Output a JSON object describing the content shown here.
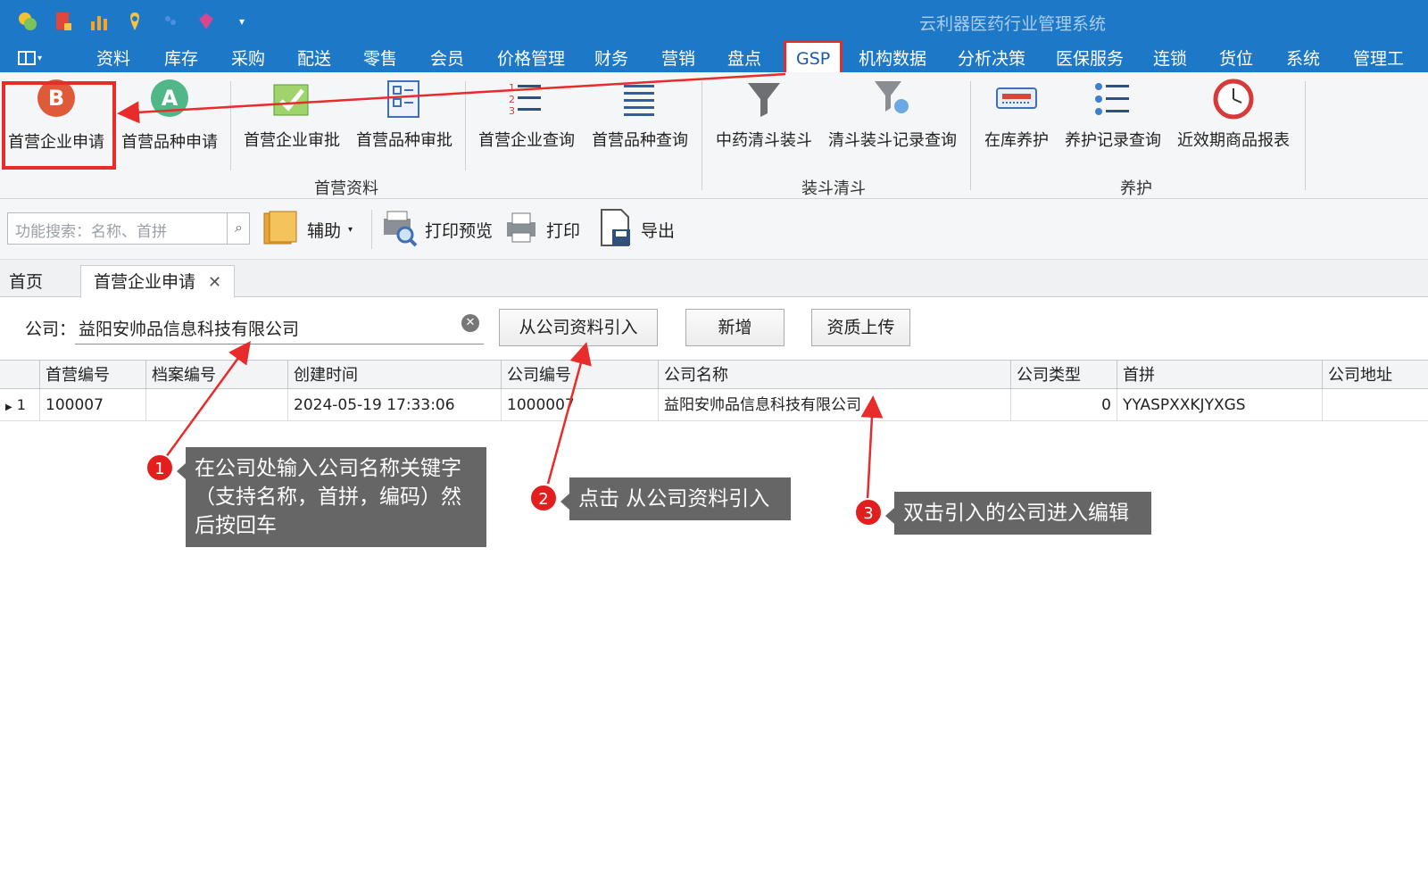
{
  "app": {
    "title": "云利器医药行业管理系统"
  },
  "menu": {
    "items": [
      "资料",
      "库存",
      "采购",
      "配送",
      "零售",
      "会员",
      "价格管理",
      "财务",
      "营销",
      "盘点",
      "GSP",
      "机构数据",
      "分析决策",
      "医保服务",
      "连锁",
      "货位",
      "系统",
      "管理工"
    ],
    "active": "GSP"
  },
  "ribbon": {
    "groups": {
      "g1": "首营资料",
      "g2": "装斗清斗",
      "g3": "养护"
    },
    "buttons": {
      "b1": "首营企业申请",
      "b2": "首营品种申请",
      "b3": "首营企业审批",
      "b4": "首营品种审批",
      "b5": "首营企业查询",
      "b6": "首营品种查询",
      "b7": "中药清斗装斗",
      "b8": "清斗装斗记录查询",
      "b9": "在库养护",
      "b10": "养护记录查询",
      "b11": "近效期商品报表"
    }
  },
  "toolbar": {
    "search_placeholder": "功能搜索：名称、首拼",
    "assist": "辅助",
    "print_preview": "打印预览",
    "print": "打印",
    "export": "导出"
  },
  "tabs": {
    "home": "首页",
    "current": "首营企业申请"
  },
  "filter": {
    "label": "公司：",
    "value": "益阳安帅品信息科技有限公司",
    "import_button": "从公司资料引入",
    "add_button": "新增",
    "upload_button": "资质上传"
  },
  "grid": {
    "columns": [
      "首营编号",
      "档案编号",
      "创建时间",
      "公司编号",
      "公司名称",
      "公司类型",
      "首拼",
      "公司地址"
    ],
    "rows": [
      {
        "index": "1",
        "cells": [
          "100007",
          "",
          "2024-05-19 17:33:06",
          "1000007",
          "益阳安帅品信息科技有限公司",
          "0",
          "YYASPXXKJYXGS",
          ""
        ]
      }
    ]
  },
  "annotations": {
    "c1": {
      "num": "1",
      "text": "在公司处输入公司名称关键字（支持名称，首拼，编码）然后按回车"
    },
    "c2": {
      "num": "2",
      "text": "点击 从公司资料引入"
    },
    "c3": {
      "num": "3",
      "text": "双击引入的公司进入编辑"
    }
  },
  "colors": {
    "titlebar": "#1e78c8",
    "highlight": "#e82b2b",
    "callout": "#666666"
  }
}
